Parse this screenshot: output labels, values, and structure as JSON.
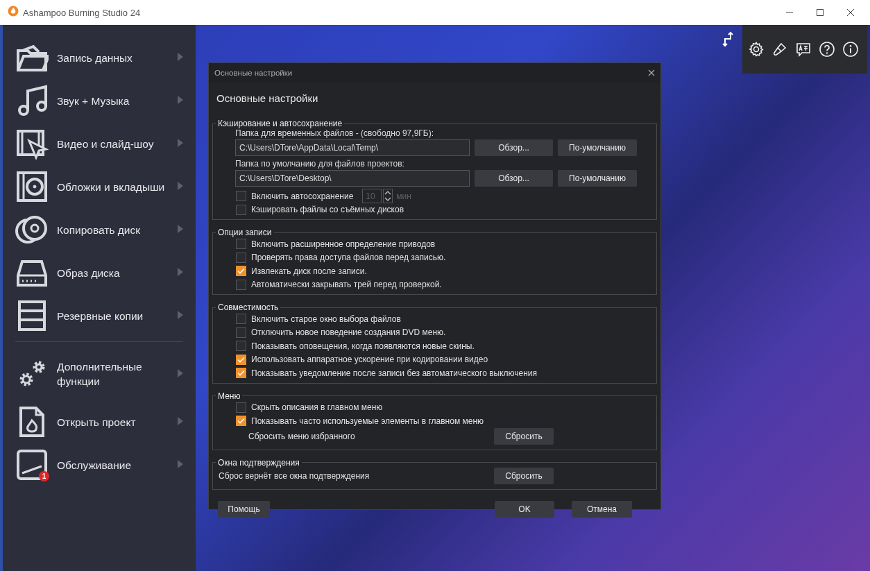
{
  "window": {
    "title": "Ashampoo Burning Studio 24"
  },
  "sidebar": {
    "sections": [
      {
        "items": [
          {
            "label": "Запись данных"
          },
          {
            "label": "Звук + Музыка"
          },
          {
            "label": "Видео и слайд-шоу"
          },
          {
            "label": "Обложки и вкладыши"
          },
          {
            "label": "Копировать диск"
          },
          {
            "label": "Образ диска"
          },
          {
            "label": "Резервные копии"
          }
        ]
      },
      {
        "items": [
          {
            "label": "Дополнительные функции"
          },
          {
            "label": "Открыть проект"
          },
          {
            "label": "Обслуживание",
            "badge": "1"
          }
        ]
      }
    ]
  },
  "dialog": {
    "title": "Основные настройки",
    "heading": "Основные настройки",
    "groups": [
      {
        "title": "Кэширование и автосохранение",
        "items": [
          {
            "kind": "path",
            "label": "Папка для временных файлов - (свободно 97,9ГБ):",
            "value": "C:\\Users\\DTore\\AppData\\Local\\Temp\\",
            "buttons": [
              "Обзор...",
              "По-умолчанию"
            ]
          },
          {
            "kind": "path",
            "label": "Папка по умолчанию для файлов проектов:",
            "value": "C:\\Users\\DTore\\Desktop\\",
            "buttons": [
              "Обзор...",
              "По-умолчанию"
            ]
          },
          {
            "kind": "checkbox",
            "label": "Включить автосохранение",
            "checked": false,
            "spinner": {
              "value": "10",
              "unit": "мин",
              "disabled": true
            }
          },
          {
            "kind": "checkbox",
            "label": "Кэшировать файлы со съёмных дисков",
            "checked": false
          }
        ]
      },
      {
        "title": "Опции записи",
        "items": [
          {
            "kind": "checkbox",
            "label": "Включить расширенное определение приводов",
            "checked": false
          },
          {
            "kind": "checkbox",
            "label": "Проверять права доступа файлов перед записью.",
            "checked": false
          },
          {
            "kind": "checkbox",
            "label": "Извлекать диск после записи.",
            "checked": true
          },
          {
            "kind": "checkbox",
            "label": "Автоматически закрывать трей перед проверкой.",
            "checked": false
          }
        ]
      },
      {
        "title": "Совместимость",
        "items": [
          {
            "kind": "checkbox",
            "label": "Включить старое окно выбора файлов",
            "checked": false
          },
          {
            "kind": "checkbox",
            "label": "Отключить новое поведение создания DVD меню.",
            "checked": false
          },
          {
            "kind": "checkbox",
            "label": "Показывать оповещения, когда появляются новые скины.",
            "checked": false
          },
          {
            "kind": "checkbox",
            "label": "Использовать аппаратное ускорение при кодировании видео",
            "checked": true
          },
          {
            "kind": "checkbox",
            "label": "Показывать уведомление после записи без автоматического выключения",
            "checked": true
          }
        ]
      },
      {
        "title": "Меню",
        "items": [
          {
            "kind": "checkbox",
            "label": "Скрыть описания в главном меню",
            "checked": false
          },
          {
            "kind": "checkbox",
            "label": "Показывать часто используемые элементы в главном меню",
            "checked": true
          },
          {
            "kind": "action",
            "label": "Сбросить меню избранного",
            "button": "Сбросить"
          }
        ]
      },
      {
        "title": "Окна подтверждения",
        "items": [
          {
            "kind": "action",
            "label": "Сброс вернёт все окна подтверждения",
            "button": "Сбросить"
          }
        ]
      }
    ],
    "footer": {
      "help": "Помощь",
      "ok": "OK",
      "cancel": "Отмена"
    }
  }
}
